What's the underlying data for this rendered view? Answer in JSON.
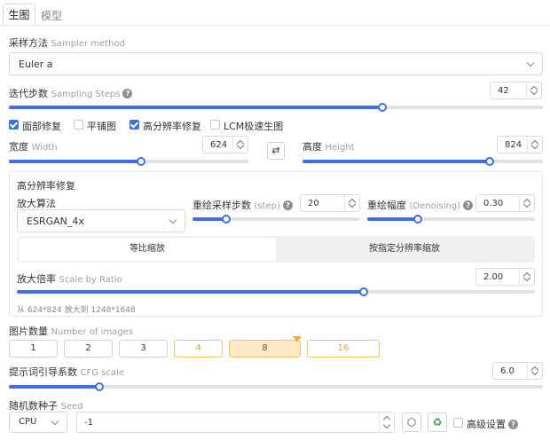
{
  "tabs": [
    {
      "label": "生图"
    },
    {
      "label": "模型"
    }
  ],
  "sampler": {
    "label": "采样方法",
    "sub": "Sampler method",
    "value": "Euler a"
  },
  "steps": {
    "label": "迭代步数",
    "sub": "Sampling Steps",
    "value": "42",
    "fraction": 0.7
  },
  "options": [
    {
      "label": "面部修复",
      "checked": true
    },
    {
      "label": "平铺图",
      "checked": false
    },
    {
      "label": "高分辨率修复",
      "checked": true
    },
    {
      "label": "LCM极速生图",
      "checked": false
    }
  ],
  "width": {
    "label": "宽度",
    "sub": "Width",
    "value": "624",
    "fraction": 0.55
  },
  "height": {
    "label": "高度",
    "sub": "Height",
    "value": "824",
    "fraction": 0.78
  },
  "hires": {
    "title": "高分辨率修复",
    "upscaler": {
      "label": "放大算法",
      "value": "ESRGAN_4x"
    },
    "resample": {
      "label": "重绘采样步数",
      "sub": "(step)",
      "value": "20",
      "fraction": 0.2
    },
    "denoise": {
      "label": "重绘幅度",
      "sub": "(Denoising)",
      "value": "0.30",
      "fraction": 0.3
    },
    "modes": [
      "等比缩放",
      "按指定分辨率缩放"
    ],
    "scale": {
      "label": "放大倍率",
      "sub": "Scale by Ratio",
      "value": "2.00",
      "fraction": 0.67
    },
    "info": "从 624*824 放大到 1248*1648"
  },
  "images": {
    "label": "图片数量",
    "sub": "Number of images",
    "options": [
      "1",
      "2",
      "3",
      "4",
      "8",
      "16"
    ],
    "selected": "8"
  },
  "cfg": {
    "label": "提示词引导系数",
    "sub": "CFG scale",
    "value": "6.0",
    "fraction": 0.17
  },
  "seed": {
    "label": "随机数种子",
    "sub": "Seed",
    "device": "CPU",
    "value": "-1",
    "advanced": "高级设置"
  }
}
